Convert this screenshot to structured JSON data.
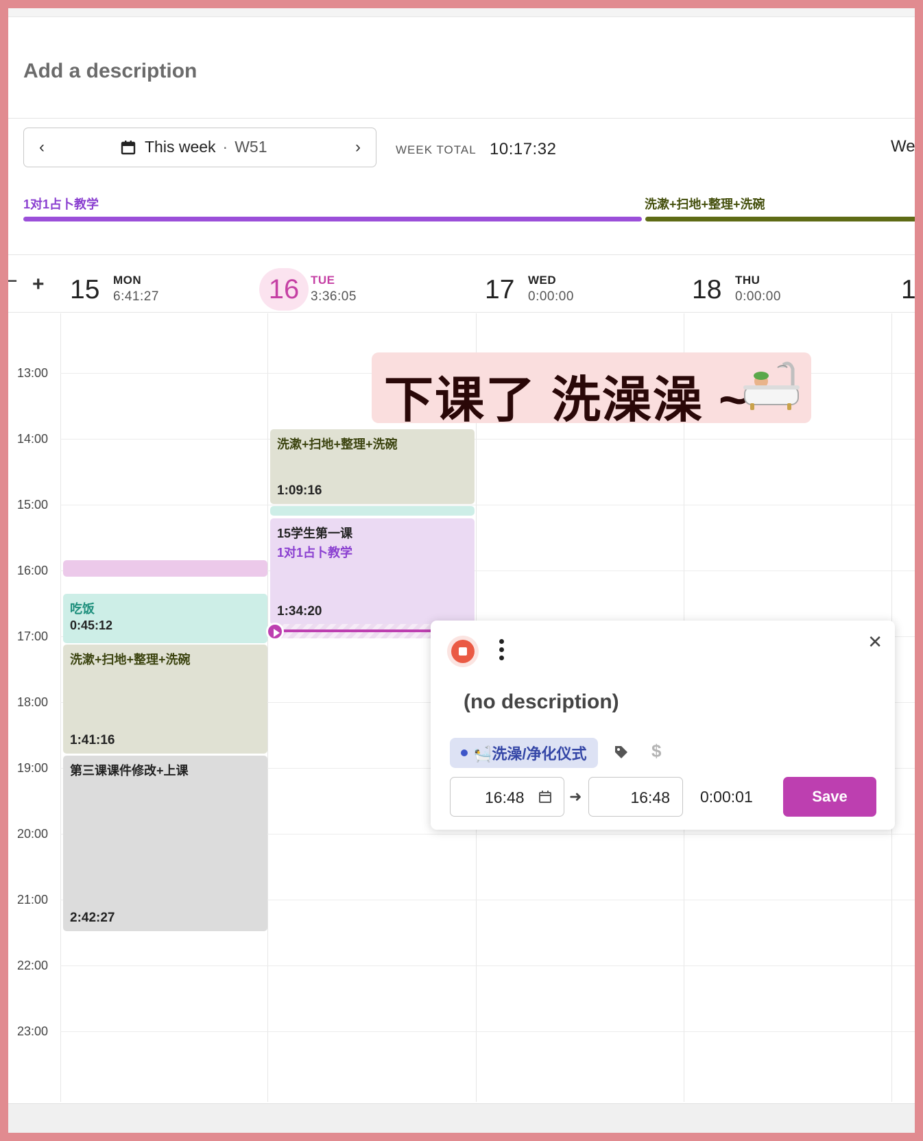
{
  "description": {
    "placeholder": "Add a description"
  },
  "week_picker": {
    "prev_icon": "chevron-left-icon",
    "label": "This week",
    "separator": "·",
    "week": "W51",
    "next_icon": "chevron-right-icon"
  },
  "week_total": {
    "label": "WEEK TOTAL",
    "value": "10:17:32",
    "cut_label": "We"
  },
  "projects_summary": [
    {
      "name": "1对1占卜教学",
      "color": "#9b4fd9"
    },
    {
      "name": "洗漱+扫地+整理+洗碗",
      "color": "#5e6b16"
    }
  ],
  "zoom": {
    "minus": "−",
    "plus": "+"
  },
  "days": [
    {
      "num": "15",
      "name": "MON",
      "total": "6:41:27"
    },
    {
      "num": "16",
      "name": "TUE",
      "total": "3:36:05",
      "today": true
    },
    {
      "num": "17",
      "name": "WED",
      "total": "0:00:00"
    },
    {
      "num": "18",
      "name": "THU",
      "total": "0:00:00"
    },
    {
      "num": "1",
      "name": "",
      "total": ""
    }
  ],
  "hours": [
    "13:00",
    "14:00",
    "15:00",
    "16:00",
    "17:00",
    "18:00",
    "19:00",
    "20:00",
    "21:00",
    "22:00",
    "23:00"
  ],
  "entries": {
    "mon_meal": {
      "title": "吃饭",
      "duration": "0:45:12",
      "color": "#cdeee7"
    },
    "mon_chores": {
      "title": "洗漱+扫地+整理+洗碗",
      "duration": "1:41:16",
      "color": "#e0e1d3"
    },
    "mon_lesson3": {
      "title": "第三课课件修改+上课",
      "duration": "2:42:27",
      "color": "#dcdcdc"
    },
    "tue_chores": {
      "title": "洗漱+扫地+整理+洗碗",
      "duration": "1:09:16",
      "color": "#e0e1d3"
    },
    "tue_lesson": {
      "title": "15学生第一课",
      "project": "1对1占卜教学",
      "duration": "1:34:20",
      "color": "#ebdaf3"
    }
  },
  "banner": {
    "text": "下课了 洗澡澡 ~",
    "icon": "bathtub-icon"
  },
  "popup": {
    "description": "(no description)",
    "project": "🛀洗澡/净化仪式",
    "project_color": "#3d55c8",
    "start": "16:48",
    "end": "16:48",
    "duration": "0:00:01",
    "save": "Save",
    "dollar": "$"
  }
}
